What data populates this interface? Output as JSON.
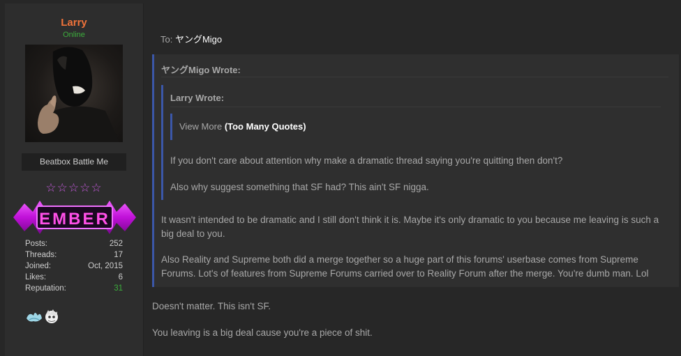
{
  "user": {
    "name": "Larry",
    "status": "Online",
    "title": "Beatbox Battle Me",
    "stars": "☆☆☆☆☆",
    "rank": "EMBER",
    "stats": [
      {
        "label": "Posts:",
        "value": "252"
      },
      {
        "label": "Threads:",
        "value": "17"
      },
      {
        "label": "Joined:",
        "value": "Oct, 2015"
      },
      {
        "label": "Likes:",
        "value": "6"
      },
      {
        "label": "Reputation:",
        "value": "31"
      }
    ]
  },
  "post": {
    "to_label": "To:",
    "to_recipient": "ヤングMigo",
    "outer_quote": {
      "author_line": "ヤングMigo Wrote:",
      "inner_quote": {
        "author_line": "Larry Wrote:",
        "view_more": "View More",
        "too_many": "(Too Many Quotes)",
        "p1": "If you don't care about attention why make a dramatic thread saying you're quitting then don't?",
        "p2": "Also why suggest something that SF had? This ain't SF nigga."
      },
      "p1": "It wasn't intended to be dramatic and I still don't think it is. Maybe it's only dramatic to you because me leaving is such a big deal to you.",
      "p2": "Also Reality and Supreme both did a merge together so a huge part of this forums' userbase comes from Supreme Forums. Lot's of features from Supreme Forums carried over to Reality Forum after the merge. You're dumb man. Lol"
    },
    "reply_1": "Doesn't matter. This isn't SF.",
    "reply_2": "You leaving is a big deal cause you're a piece of shit."
  },
  "colors": {
    "username": "#f0733a",
    "online": "#3cae3c",
    "quote_border": "#3b57a8",
    "rank_glow": "#d020e0"
  }
}
